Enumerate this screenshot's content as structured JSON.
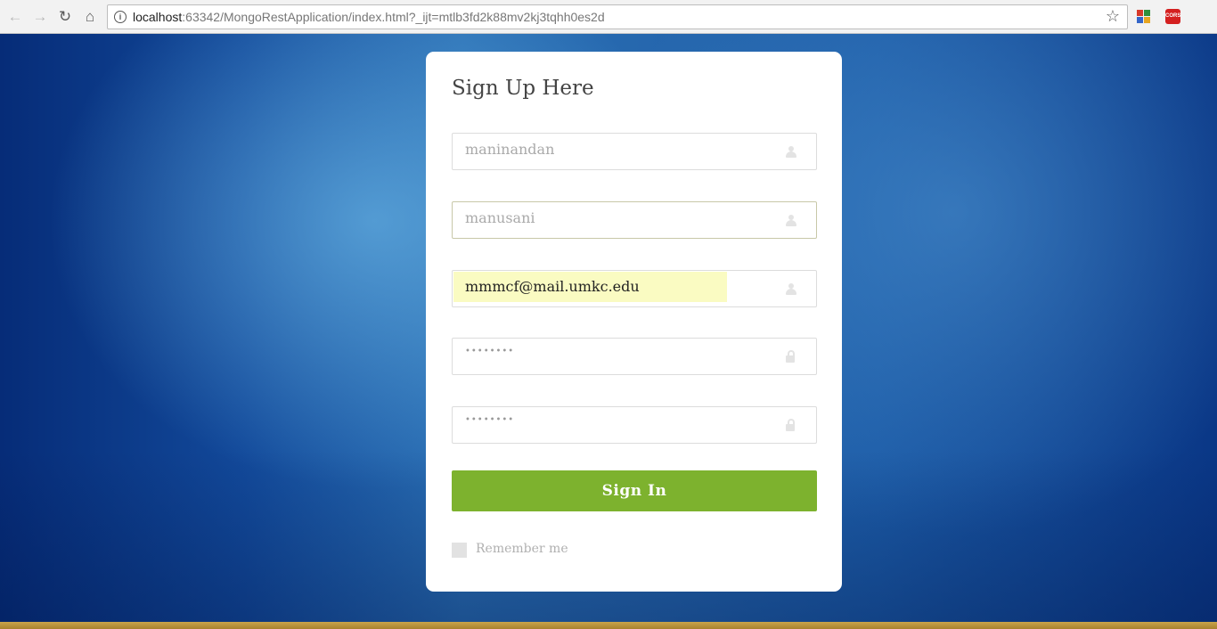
{
  "browser": {
    "url_host": "localhost",
    "url_rest": ":63342/MongoRestApplication/index.html?_ijt=mtlb3fd2k88mv2kj3tqhh0es2d",
    "extension_cors_label": "CORS"
  },
  "form": {
    "title": "Sign Up Here",
    "fields": [
      {
        "name": "first-name",
        "value": "maninandan",
        "icon": "user-icon"
      },
      {
        "name": "last-name",
        "value": "manusani",
        "icon": "user-icon"
      },
      {
        "name": "email",
        "value": "mmmcf@mail.umkc.edu",
        "icon": "user-icon",
        "autofilled": true
      },
      {
        "name": "password",
        "value": "••••••••",
        "icon": "lock-icon"
      },
      {
        "name": "confirm-password",
        "value": "••••••••",
        "icon": "lock-icon"
      }
    ],
    "submit_label": "Sign In",
    "remember_label": "Remember me",
    "colors": {
      "button": "#7db22e",
      "autofill": "#fafbc2"
    }
  }
}
